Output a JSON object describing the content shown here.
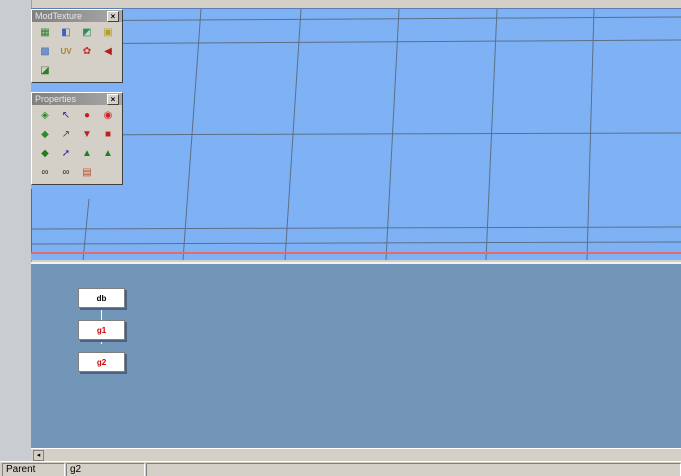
{
  "toolbars": {
    "modtexture": {
      "title": "ModTexture",
      "close": "×",
      "tools": [
        {
          "icon": "texture-map-icon",
          "glyph": "▦",
          "color": "#2a7f2a"
        },
        {
          "icon": "texture-project-icon",
          "glyph": "◧",
          "color": "#3a5fbf"
        },
        {
          "icon": "texture-edit-icon",
          "glyph": "◩",
          "color": "#2a8f5a"
        },
        {
          "icon": "texture-image-icon",
          "glyph": "▣",
          "color": "#b0a020"
        },
        {
          "icon": "texture-grid-icon",
          "glyph": "▩",
          "color": "#3a6fbf"
        },
        {
          "icon": "uv-editor-icon",
          "glyph": "UV",
          "color": "#b08020"
        },
        {
          "icon": "texture-swap-icon",
          "glyph": "✿",
          "color": "#c03030"
        },
        {
          "icon": "texture-back-icon",
          "glyph": "◀",
          "color": "#b02020"
        },
        {
          "icon": "texture-transform-icon",
          "glyph": "◪",
          "color": "#2a7f2a"
        }
      ]
    },
    "properties": {
      "title": "Properties",
      "close": "×",
      "tools": [
        {
          "icon": "material-icon",
          "glyph": "◈",
          "color": "#2a8f2a"
        },
        {
          "icon": "property-icon",
          "glyph": "↖",
          "color": "#2a2a8f"
        },
        {
          "icon": "paint-red-icon",
          "glyph": "●",
          "color": "#c02020"
        },
        {
          "icon": "paint-drop-icon",
          "glyph": "◉",
          "color": "#d02020"
        },
        {
          "icon": "texture-prop-icon",
          "glyph": "◆",
          "color": "#2a8f2a"
        },
        {
          "icon": "light-prop-icon",
          "glyph": "↗",
          "color": "#4a4a4a"
        },
        {
          "icon": "red-paint-icon",
          "glyph": "▼",
          "color": "#c02020"
        },
        {
          "icon": "red-tag-icon",
          "glyph": "■",
          "color": "#c02020"
        },
        {
          "icon": "green-paint-icon",
          "glyph": "◆",
          "color": "#208020"
        },
        {
          "icon": "arrow-prop-icon",
          "glyph": "➚",
          "color": "#2a2a8f"
        },
        {
          "icon": "dfr-prop-icon",
          "glyph": "▲",
          "color": "#208020"
        },
        {
          "icon": "dfr-tree-icon",
          "glyph": "▲",
          "color": "#208020"
        },
        {
          "icon": "binoculars-icon",
          "glyph": "∞",
          "color": "#2a2a2a"
        },
        {
          "icon": "binoculars-alt-icon",
          "glyph": "∞",
          "color": "#2a2a2a"
        },
        {
          "icon": "color-swatch-icon",
          "glyph": "▤",
          "color": "#c05020"
        }
      ]
    }
  },
  "schematic": {
    "nodes": [
      {
        "label": "db",
        "role": "root"
      },
      {
        "label": "g1",
        "role": "child"
      },
      {
        "label": "g2",
        "role": "child"
      }
    ]
  },
  "scrollbar": {
    "left_arrow": "◂"
  },
  "statusbar": {
    "cell1": "Parent",
    "cell2": "g2",
    "cell3": ""
  },
  "colors": {
    "viewport_bg": "#7fb2f5",
    "schematic_bg": "#7396b8",
    "grid_line": "#5c6f88",
    "selected_node_text": "#cc0000"
  }
}
